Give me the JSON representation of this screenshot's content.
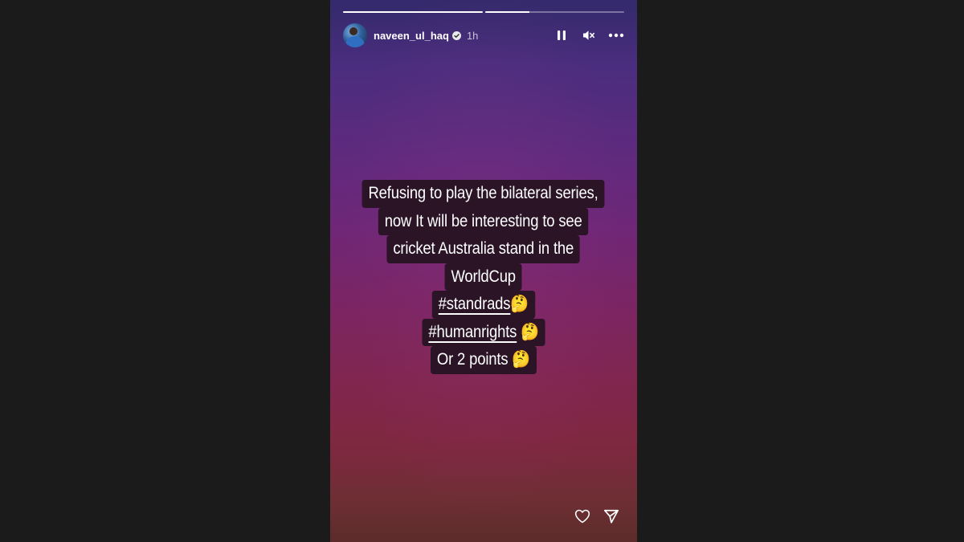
{
  "story": {
    "progress": [
      1.0,
      0.32
    ],
    "user": {
      "username": "naveen_ul_haq",
      "verified": true,
      "time": "1h"
    },
    "actions": {
      "pause_icon": "pause-icon",
      "mute_icon": "volume-muted-icon",
      "more_icon": "more-options-icon"
    },
    "caption_lines": [
      {
        "text": "Refusing to play the bilateral series,"
      },
      {
        "text": "now It will be interesting to see"
      },
      {
        "text": "cricket Australia stand  in the"
      },
      {
        "text": "WorldCup"
      },
      {
        "tag": "#standrads",
        "emoji": "🤔"
      },
      {
        "tag": "#humanrights",
        "emoji": "🤔"
      },
      {
        "text": "Or 2 points",
        "emoji": "🤔"
      }
    ],
    "footer": {
      "like_icon": "heart-icon",
      "share_icon": "send-icon"
    }
  }
}
